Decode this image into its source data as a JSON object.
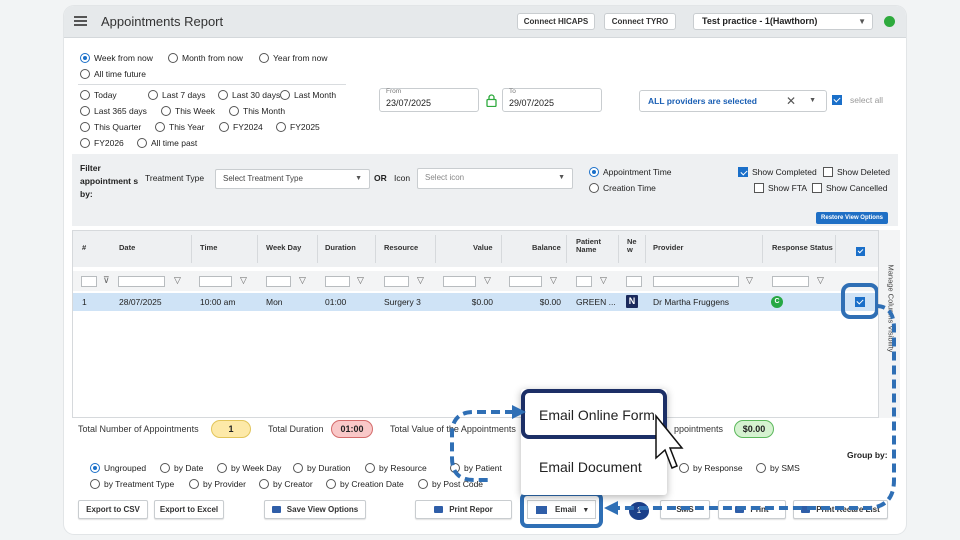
{
  "header": {
    "title": "Appointments Report",
    "btn_hicaps": "Connect HICAPS",
    "btn_tyro": "Connect TYRO",
    "practice": "Test practice - 1(Hawthorn)",
    "status_color": "#2eaa3d"
  },
  "range1": [
    "Week from now",
    "Month from now",
    "Year from now",
    "All time future"
  ],
  "range2": [
    "Today",
    "Last 7 days",
    "Last 30 days",
    "Last Month",
    "Last 365 days",
    "This Week",
    "This Month",
    "This Quarter",
    "This Year",
    "FY2024",
    "FY2025",
    "FY2026",
    "All time past"
  ],
  "dates": {
    "from_label": "From",
    "from_value": "23/07/2025",
    "to_label": "To",
    "to_value": "29/07/2025"
  },
  "providers": {
    "value": "ALL providers are selected",
    "select_all": "select all"
  },
  "filter": {
    "label": "Filter appointment s by:",
    "treatment_label": "Treatment Type",
    "treatment_placeholder": "Select Treatment Type",
    "or_label": "OR",
    "icon_label": "Icon",
    "icon_placeholder": "Select icon",
    "appt_time": "Appointment Time",
    "creation_time": "Creation Time",
    "show_completed": "Show Completed",
    "show_deleted": "Show Deleted",
    "show_fta": "Show FTA",
    "show_cancelled": "Show Cancelled",
    "restore": "Restore View Options"
  },
  "table": {
    "headers": [
      "#",
      "Date",
      "Time",
      "Week Day",
      "Duration",
      "Resource",
      "Value",
      "Balance",
      "Patient Name",
      "Ne w",
      "Provider",
      "Response Status"
    ],
    "row": {
      "num": "1",
      "date": "28/07/2025",
      "time": "10:00 am",
      "weekday": "Mon",
      "duration": "01:00",
      "resource": "Surgery 3",
      "value": "$0.00",
      "balance": "$0.00",
      "patient": "GREEN ...",
      "new_badge": "N",
      "provider": "Dr Martha Fruggens",
      "response_badge": "C"
    },
    "side_tab": "Manage Columns Visibility"
  },
  "totals": {
    "count_label": "Total Number of Appointments",
    "count_value": "1",
    "duration_label": "Total Duration",
    "duration_value": "01:00",
    "value_label": "Total Value of the Appointments",
    "balance_label": "ppointments",
    "balance_value": "$0.00"
  },
  "group": {
    "label": "Group by:",
    "row1": [
      "Ungrouped",
      "by Date",
      "by Week Day",
      "by Duration",
      "by Resource",
      "by Patient",
      "by Response",
      "by SMS"
    ],
    "row2": [
      "by Treatment Type",
      "by Provider",
      "by Creator",
      "by Creation Date",
      "by Post Code"
    ]
  },
  "buttons": {
    "csv": "Export to CSV",
    "excel": "Export to Excel",
    "save": "Save View Options",
    "print": "Print Repor",
    "email": "Email",
    "count": "1",
    "sms": "SMS",
    "print2": "Print",
    "print_list": "Print Recare List"
  },
  "menu": {
    "item1": "Email Online Form",
    "item2": "Email Document"
  }
}
